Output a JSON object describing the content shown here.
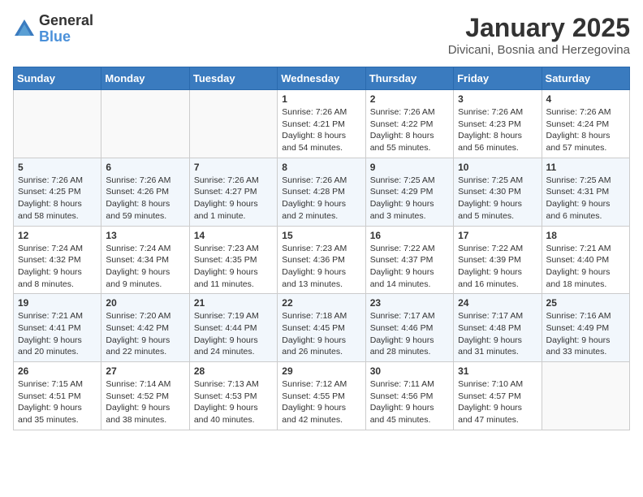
{
  "header": {
    "logo_general": "General",
    "logo_blue": "Blue",
    "month_title": "January 2025",
    "location": "Divicani, Bosnia and Herzegovina"
  },
  "days_of_week": [
    "Sunday",
    "Monday",
    "Tuesday",
    "Wednesday",
    "Thursday",
    "Friday",
    "Saturday"
  ],
  "weeks": [
    [
      {
        "day": "",
        "info": ""
      },
      {
        "day": "",
        "info": ""
      },
      {
        "day": "",
        "info": ""
      },
      {
        "day": "1",
        "info": "Sunrise: 7:26 AM\nSunset: 4:21 PM\nDaylight: 8 hours\nand 54 minutes."
      },
      {
        "day": "2",
        "info": "Sunrise: 7:26 AM\nSunset: 4:22 PM\nDaylight: 8 hours\nand 55 minutes."
      },
      {
        "day": "3",
        "info": "Sunrise: 7:26 AM\nSunset: 4:23 PM\nDaylight: 8 hours\nand 56 minutes."
      },
      {
        "day": "4",
        "info": "Sunrise: 7:26 AM\nSunset: 4:24 PM\nDaylight: 8 hours\nand 57 minutes."
      }
    ],
    [
      {
        "day": "5",
        "info": "Sunrise: 7:26 AM\nSunset: 4:25 PM\nDaylight: 8 hours\nand 58 minutes."
      },
      {
        "day": "6",
        "info": "Sunrise: 7:26 AM\nSunset: 4:26 PM\nDaylight: 8 hours\nand 59 minutes."
      },
      {
        "day": "7",
        "info": "Sunrise: 7:26 AM\nSunset: 4:27 PM\nDaylight: 9 hours\nand 1 minute."
      },
      {
        "day": "8",
        "info": "Sunrise: 7:26 AM\nSunset: 4:28 PM\nDaylight: 9 hours\nand 2 minutes."
      },
      {
        "day": "9",
        "info": "Sunrise: 7:25 AM\nSunset: 4:29 PM\nDaylight: 9 hours\nand 3 minutes."
      },
      {
        "day": "10",
        "info": "Sunrise: 7:25 AM\nSunset: 4:30 PM\nDaylight: 9 hours\nand 5 minutes."
      },
      {
        "day": "11",
        "info": "Sunrise: 7:25 AM\nSunset: 4:31 PM\nDaylight: 9 hours\nand 6 minutes."
      }
    ],
    [
      {
        "day": "12",
        "info": "Sunrise: 7:24 AM\nSunset: 4:32 PM\nDaylight: 9 hours\nand 8 minutes."
      },
      {
        "day": "13",
        "info": "Sunrise: 7:24 AM\nSunset: 4:34 PM\nDaylight: 9 hours\nand 9 minutes."
      },
      {
        "day": "14",
        "info": "Sunrise: 7:23 AM\nSunset: 4:35 PM\nDaylight: 9 hours\nand 11 minutes."
      },
      {
        "day": "15",
        "info": "Sunrise: 7:23 AM\nSunset: 4:36 PM\nDaylight: 9 hours\nand 13 minutes."
      },
      {
        "day": "16",
        "info": "Sunrise: 7:22 AM\nSunset: 4:37 PM\nDaylight: 9 hours\nand 14 minutes."
      },
      {
        "day": "17",
        "info": "Sunrise: 7:22 AM\nSunset: 4:39 PM\nDaylight: 9 hours\nand 16 minutes."
      },
      {
        "day": "18",
        "info": "Sunrise: 7:21 AM\nSunset: 4:40 PM\nDaylight: 9 hours\nand 18 minutes."
      }
    ],
    [
      {
        "day": "19",
        "info": "Sunrise: 7:21 AM\nSunset: 4:41 PM\nDaylight: 9 hours\nand 20 minutes."
      },
      {
        "day": "20",
        "info": "Sunrise: 7:20 AM\nSunset: 4:42 PM\nDaylight: 9 hours\nand 22 minutes."
      },
      {
        "day": "21",
        "info": "Sunrise: 7:19 AM\nSunset: 4:44 PM\nDaylight: 9 hours\nand 24 minutes."
      },
      {
        "day": "22",
        "info": "Sunrise: 7:18 AM\nSunset: 4:45 PM\nDaylight: 9 hours\nand 26 minutes."
      },
      {
        "day": "23",
        "info": "Sunrise: 7:17 AM\nSunset: 4:46 PM\nDaylight: 9 hours\nand 28 minutes."
      },
      {
        "day": "24",
        "info": "Sunrise: 7:17 AM\nSunset: 4:48 PM\nDaylight: 9 hours\nand 31 minutes."
      },
      {
        "day": "25",
        "info": "Sunrise: 7:16 AM\nSunset: 4:49 PM\nDaylight: 9 hours\nand 33 minutes."
      }
    ],
    [
      {
        "day": "26",
        "info": "Sunrise: 7:15 AM\nSunset: 4:51 PM\nDaylight: 9 hours\nand 35 minutes."
      },
      {
        "day": "27",
        "info": "Sunrise: 7:14 AM\nSunset: 4:52 PM\nDaylight: 9 hours\nand 38 minutes."
      },
      {
        "day": "28",
        "info": "Sunrise: 7:13 AM\nSunset: 4:53 PM\nDaylight: 9 hours\nand 40 minutes."
      },
      {
        "day": "29",
        "info": "Sunrise: 7:12 AM\nSunset: 4:55 PM\nDaylight: 9 hours\nand 42 minutes."
      },
      {
        "day": "30",
        "info": "Sunrise: 7:11 AM\nSunset: 4:56 PM\nDaylight: 9 hours\nand 45 minutes."
      },
      {
        "day": "31",
        "info": "Sunrise: 7:10 AM\nSunset: 4:57 PM\nDaylight: 9 hours\nand 47 minutes."
      },
      {
        "day": "",
        "info": ""
      }
    ]
  ]
}
